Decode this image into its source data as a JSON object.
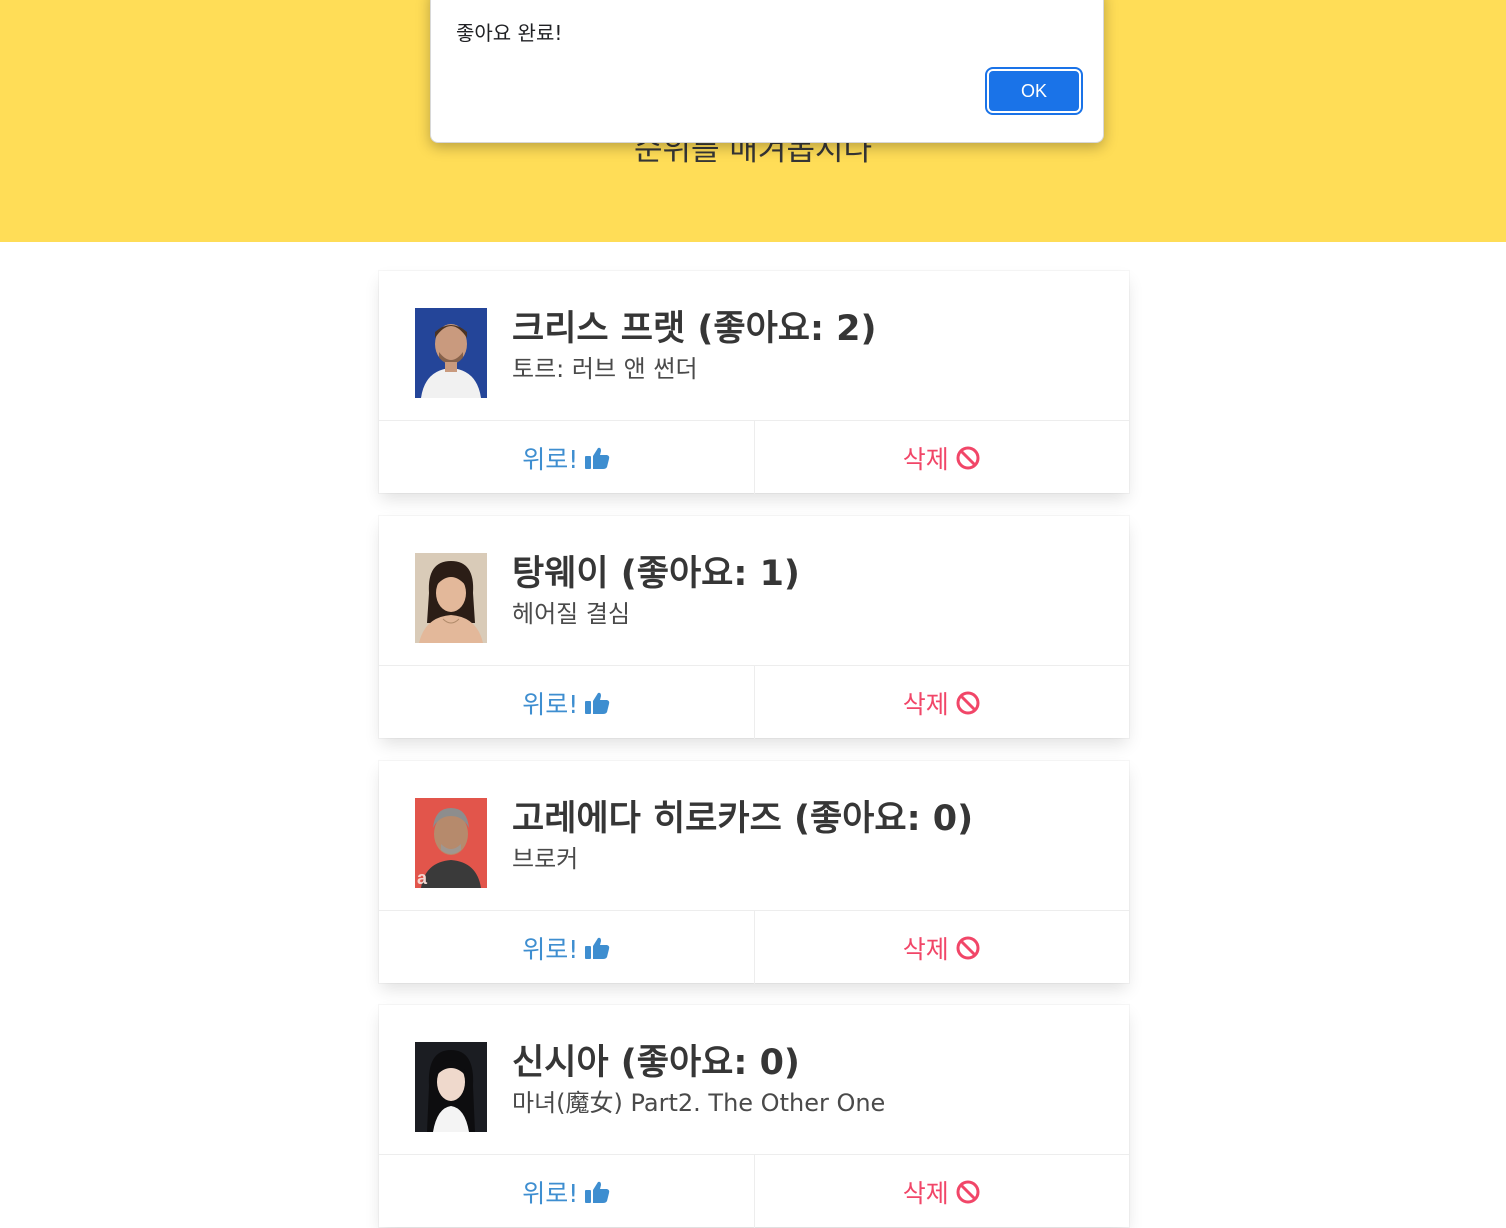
{
  "hero": {
    "subtitle": "순위를 매겨봅시다"
  },
  "alert": {
    "message": "좋아요 완료!",
    "ok_label": "OK"
  },
  "cards": [
    {
      "name": "크리스 프랫 (좋아요: 2)",
      "movie": "토르: 러브 앤 썬더",
      "up_label": "위로!",
      "delete_label": "삭제"
    },
    {
      "name": "탕웨이 (좋아요: 1)",
      "movie": "헤어질 결심",
      "up_label": "위로!",
      "delete_label": "삭제"
    },
    {
      "name": "고레에다 히로카즈 (좋아요: 0)",
      "movie": "브로커",
      "up_label": "위로!",
      "delete_label": "삭제"
    },
    {
      "name": "신시아 (좋아요: 0)",
      "movie": "마녀(魔女) Part2. The Other One",
      "up_label": "위로!",
      "delete_label": "삭제"
    }
  ],
  "colors": {
    "hero_background": "#ffdd57",
    "up_color": "#3e8ed0",
    "delete_color": "#f14668",
    "ok_button": "#1a73e8"
  },
  "icons": {
    "up": "thumbs-up-icon",
    "delete": "ban-icon"
  }
}
